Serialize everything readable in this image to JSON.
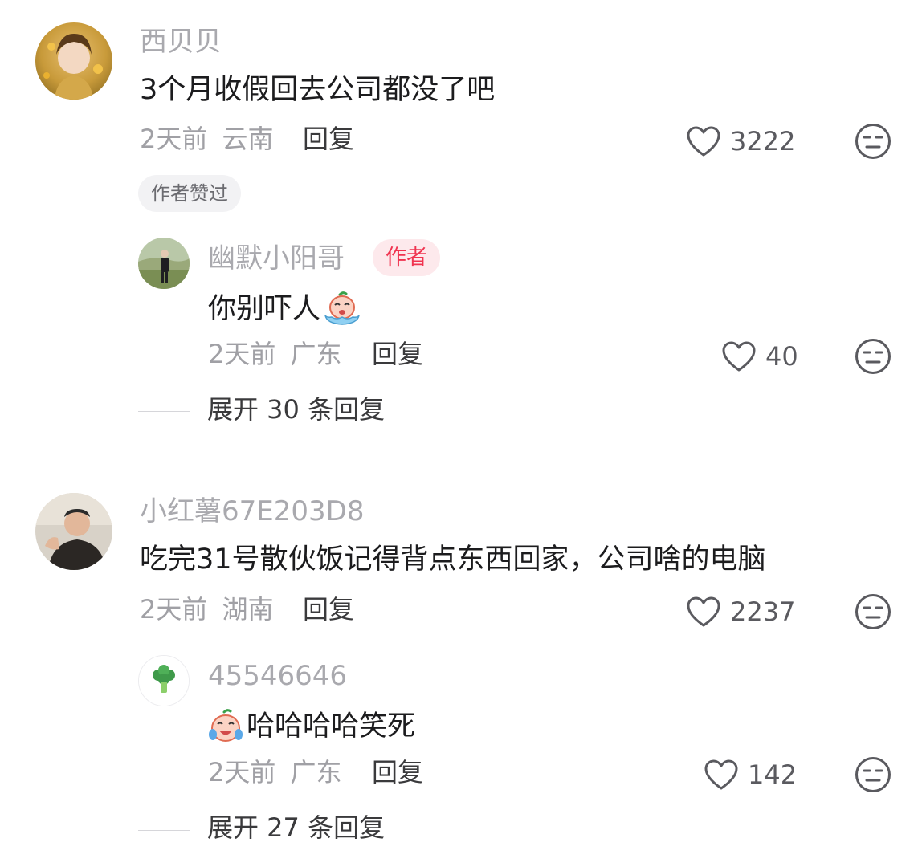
{
  "comments": [
    {
      "username": "西贝贝",
      "content": "3个月收假回去公司都没了吧",
      "time": "2天前",
      "location": "云南",
      "reply_label": "回复",
      "likes": "3222",
      "liked_badge": "作者赞过",
      "replies": [
        {
          "username": "幽默小阳哥",
          "author_badge": "作者",
          "content": "你别吓人",
          "emoji": "crying-emoji",
          "time": "2天前",
          "location": "广东",
          "reply_label": "回复",
          "likes": "40"
        }
      ],
      "expand_label": "展开 30 条回复"
    },
    {
      "username": "小红薯67E203D8",
      "content": "吃完31号散伙饭记得背点东西回家，公司啥的电脑",
      "time": "2天前",
      "location": "湖南",
      "reply_label": "回复",
      "likes": "2237",
      "replies": [
        {
          "username": "45546646",
          "emoji": "laugh-cry-emoji",
          "content": "哈哈哈哈笑死",
          "time": "2天前",
          "location": "广东",
          "reply_label": "回复",
          "likes": "142"
        }
      ],
      "expand_label": "展开 27 条回复"
    }
  ],
  "colors": {
    "username": "#a9a9ae",
    "text": "#1c1c1e",
    "meta": "#a0a0a5",
    "author_badge_bg": "#fde9ec",
    "author_badge_text": "#f0334f"
  }
}
